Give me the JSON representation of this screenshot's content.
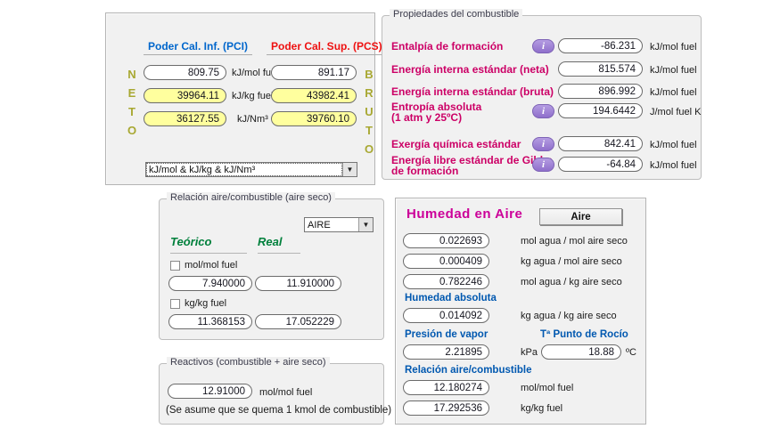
{
  "pci": {
    "col1_header": "Poder Cal. Inf. (PCI)",
    "col2_header": "Poder Cal. Sup. (PCS)",
    "neto": [
      "N",
      "E",
      "T",
      "O"
    ],
    "bruto": [
      "B",
      "R",
      "U",
      "T",
      "O"
    ],
    "rows": [
      {
        "pci": "809.75",
        "unit": "kJ/mol fuel",
        "pcs": "891.17"
      },
      {
        "pci": "39964.11",
        "unit": "kJ/kg fuel",
        "pcs": "43982.41"
      },
      {
        "pci": "36127.55",
        "unit": "kJ/Nm³",
        "pcs": "39760.10"
      }
    ],
    "unit_selector": "kJ/mol & kJ/kg & kJ/Nm³"
  },
  "properties": {
    "title": "Propiedades del combustible",
    "info_glyph": "i",
    "rows": [
      {
        "label": "Entalpía de formación",
        "label2": "",
        "value": "-86.231",
        "unit": "kJ/mol fuel"
      },
      {
        "label": "Energía interna estándar (neta)",
        "label2": "",
        "value": "815.574",
        "unit": "kJ/mol fuel"
      },
      {
        "label": "Energía interna estándar (bruta)",
        "label2": "",
        "value": "896.992",
        "unit": "kJ/mol fuel"
      },
      {
        "label": "Entropía absoluta",
        "label2": " (1 atm y 25ºC)",
        "value": "194.6442",
        "unit": "J/mol fuel K"
      },
      {
        "label": "Exergía química estándar",
        "label2": "",
        "value": "842.41",
        "unit": "kJ/mol fuel"
      },
      {
        "label": "Energía libre estándar de Gibbs",
        "label2": "de formación",
        "value": "-64.84",
        "unit": "kJ/mol fuel"
      }
    ]
  },
  "ratio": {
    "title": "Relación aire/combustible (aire seco)",
    "selector": "AIRE",
    "col1": "Teórico",
    "col2": "Real",
    "check1": "mol/mol fuel",
    "check2": "kg/kg fuel",
    "mol_teorico": "7.940000",
    "mol_real": "11.910000",
    "kg_teorico": "11.368153",
    "kg_real": "17.052229"
  },
  "reactants": {
    "title": "Reactivos (combustible + aire seco)",
    "value": "12.91000",
    "unit": "mol/mol fuel",
    "note": "(Se asume que se quema 1 kmol de combustible)"
  },
  "humidity": {
    "title": "Humedad en Aire",
    "button": "Aire",
    "rows": [
      {
        "value": "0.022693",
        "unit": "mol agua / mol aire seco"
      },
      {
        "value": "0.000409",
        "unit": "kg agua / mol aire seco"
      },
      {
        "value": "0.782246",
        "unit": "mol agua / kg aire seco"
      }
    ],
    "abs_label": "Humedad absoluta",
    "abs_value": "0.014092",
    "abs_unit": "kg agua / kg aire seco",
    "vapor_label": "Presión de vapor",
    "vapor_value": "2.21895",
    "vapor_unit": "kPa",
    "dew_label": "Tª Punto de Rocío",
    "dew_value": "18.88",
    "dew_unit": "ºC",
    "afr_label": "Relación aire/combustible",
    "afr_mol_value": "12.180274",
    "afr_mol_unit": "mol/mol fuel",
    "afr_kg_value": "17.292536",
    "afr_kg_unit": "kg/kg fuel"
  },
  "colors": {
    "pci_blue": "#0066CC",
    "pcs_red": "#EE1111",
    "neto_bruto_olive": "#A8A832",
    "label_magenta": "#CC0066",
    "title_magenta": "#CC0099",
    "info_purple": "#8F6FCB",
    "teorico_green": "#00803C",
    "humidity_blue": "#0058B0",
    "field_highlight_yellow": "#FFFF9E",
    "panel_gray": "#F1F1F1"
  }
}
